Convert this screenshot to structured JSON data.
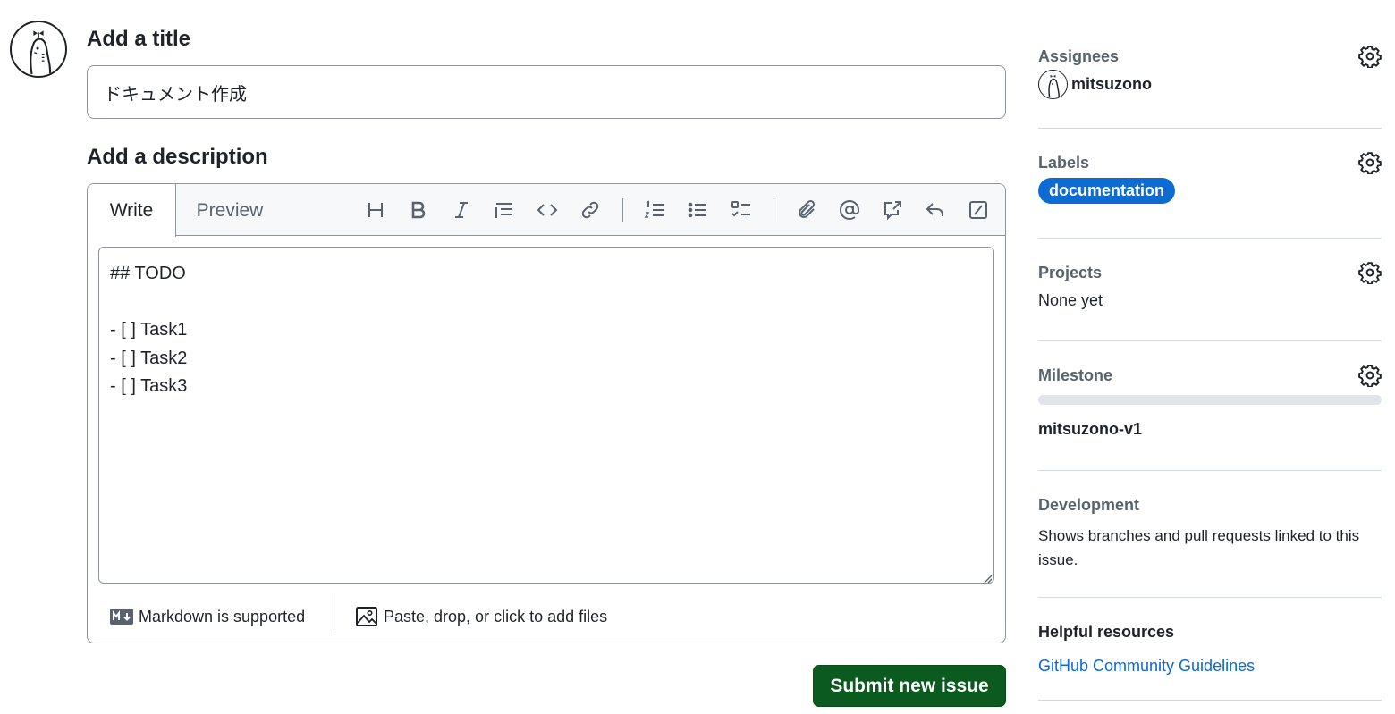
{
  "form": {
    "title_heading": "Add a title",
    "title_value": "ドキュメント作成",
    "description_heading": "Add a description",
    "tabs": {
      "write": "Write",
      "preview": "Preview"
    },
    "toolbar_icons": [
      "heading-icon",
      "bold-icon",
      "italic-icon",
      "quote-icon",
      "code-icon",
      "link-icon",
      "numbered-list-icon",
      "unordered-list-icon",
      "task-list-icon",
      "attach-icon",
      "mention-icon",
      "reference-icon",
      "reply-icon",
      "slash-command-icon"
    ],
    "body": "## TODO\n\n- [ ] Task1\n- [ ] Task2\n- [ ] Task3",
    "markdown_note": "Markdown is supported",
    "files_note": "Paste, drop, or click to add files",
    "submit_label": "Submit new issue"
  },
  "sidebar": {
    "assignees": {
      "heading": "Assignees",
      "user": "mitsuzono"
    },
    "labels": {
      "heading": "Labels",
      "label": "documentation",
      "label_color": "#0c6cd4"
    },
    "projects": {
      "heading": "Projects",
      "value": "None yet"
    },
    "milestone": {
      "heading": "Milestone",
      "name": "mitsuzono-v1",
      "progress": 0
    },
    "development": {
      "heading": "Development",
      "text": "Shows branches and pull requests linked to this issue."
    },
    "helpful": {
      "heading": "Helpful resources",
      "link": "GitHub Community Guidelines"
    }
  },
  "colors": {
    "submit": "#0b5a1f",
    "link": "#0969da",
    "label": "#0c6cd4"
  }
}
